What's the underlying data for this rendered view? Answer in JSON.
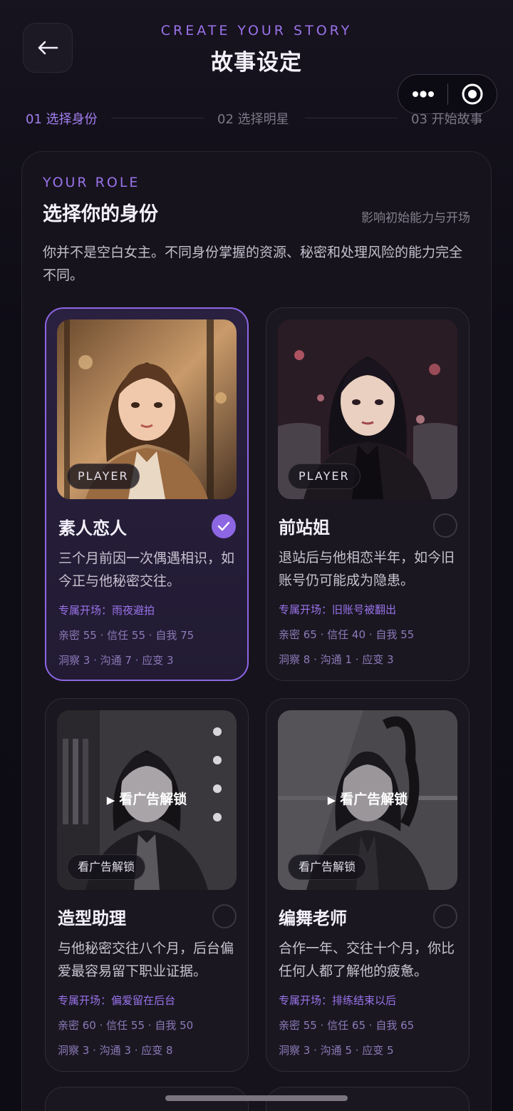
{
  "header": {
    "subtitle": "CREATE YOUR STORY",
    "title": "故事设定",
    "back_icon": "arrow-left-icon",
    "capsule": {
      "more_icon": "more-dots-icon",
      "close_icon": "target-circle-icon"
    }
  },
  "steps": [
    {
      "label": "01 选择身份",
      "active": true
    },
    {
      "label": "02 选择明星",
      "active": false
    },
    {
      "label": "03 开始故事",
      "active": false
    }
  ],
  "role": {
    "eyebrow": "YOUR ROLE",
    "title": "选择你的身份",
    "hint": "影响初始能力与开场",
    "description": "你并不是空白女主。不同身份掌握的资源、秘密和处理风险的能力完全不同。"
  },
  "cards": [
    {
      "name": "素人恋人",
      "badge": "PLAYER",
      "selected": true,
      "locked": false,
      "description": "三个月前因一次偶遇相识，如今正与他秘密交往。",
      "opening": "专属开场：雨夜避拍",
      "stats": "亲密 55 · 信任 55 · 自我 75",
      "skills": "洞察 3 · 沟通 7 · 应变 3"
    },
    {
      "name": "前站姐",
      "badge": "PLAYER",
      "selected": false,
      "locked": false,
      "description": "退站后与他相恋半年，如今旧账号仍可能成为隐患。",
      "opening": "专属开场：旧账号被翻出",
      "stats": "亲密 65 · 信任 40 · 自我 55",
      "skills": "洞察 8 · 沟通 1 · 应变 3"
    },
    {
      "name": "造型助理",
      "badge": "看广告解锁",
      "unlock_label": "看广告解锁",
      "selected": false,
      "locked": true,
      "description": "与他秘密交往八个月，后台偏爱最容易留下职业证据。",
      "opening": "专属开场：偏爱留在后台",
      "stats": "亲密 60 · 信任 55 · 自我 50",
      "skills": "洞察 3 · 沟通 3 · 应变 8"
    },
    {
      "name": "编舞老师",
      "badge": "看广告解锁",
      "unlock_label": "看广告解锁",
      "selected": false,
      "locked": true,
      "description": "合作一年、交往十个月，你比任何人都了解他的疲惫。",
      "opening": "专属开场：排练结束以后",
      "stats": "亲密 55 · 信任 65 · 自我 65",
      "skills": "洞察 3 · 沟通 5 · 应变 5"
    }
  ],
  "colors": {
    "accent": "#8d66e4",
    "accent_text": "#9a73ea",
    "background": "#0d0b14",
    "card": "#1a1721"
  }
}
